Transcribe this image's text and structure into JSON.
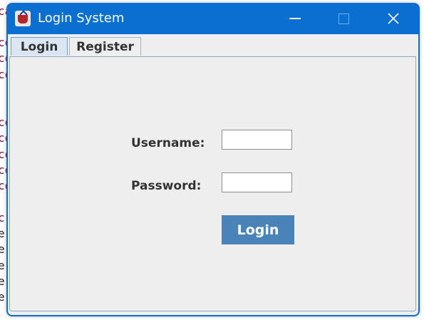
{
  "window": {
    "title": "Login System",
    "app_icon": "java-cup-icon",
    "controls": [
      "minimize-icon",
      "maximize-icon",
      "close-icon"
    ]
  },
  "tabs": [
    {
      "label": "Login",
      "active": true
    },
    {
      "label": "Register",
      "active": false
    }
  ],
  "form": {
    "username_label": "Username:",
    "username_value": "",
    "password_label": "Password:",
    "password_value": "",
    "login_button": "Login"
  },
  "background_code": {
    "lines": [
      "ca",
      "co",
      "co",
      "co",
      "",
      "co",
      "co",
      "co",
      "co",
      "co",
      "",
      "c",
      "e",
      "e",
      "e",
      "e",
      "e"
    ]
  },
  "colors": {
    "titlebar": "#0a6fd0",
    "button": "#4a83b8",
    "panel": "#eeeeee"
  }
}
